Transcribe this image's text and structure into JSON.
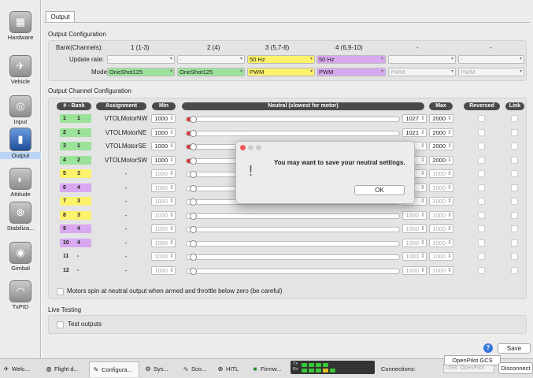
{
  "sidebar": {
    "items": [
      {
        "label": "Hardware",
        "icon": "chip-icon"
      },
      {
        "label": "Vehicle",
        "icon": "wing-icon"
      },
      {
        "label": "Input",
        "icon": "transmitter-icon"
      },
      {
        "label": "Output",
        "icon": "motor-icon"
      },
      {
        "label": "Attitude",
        "icon": "gauge-icon"
      },
      {
        "label": "Stabiliza...",
        "icon": "gyro-icon"
      },
      {
        "label": "Gimbal",
        "icon": "camera-icon"
      },
      {
        "label": "TxPID",
        "icon": "meter-icon"
      }
    ]
  },
  "tab": {
    "label": "Output"
  },
  "output_config": {
    "title": "Output Configuration",
    "bank_label": "Bank(Channels):",
    "update_label": "Update rate:",
    "mode_label": "Mode:",
    "banks": [
      {
        "channels": "1 (1-3)",
        "rate": "-",
        "mode": "OneShot125"
      },
      {
        "channels": "2 (4)",
        "rate": "-",
        "mode": "OneShot125"
      },
      {
        "channels": "3 (5,7-8)",
        "rate": "50 Hz",
        "mode": "PWM"
      },
      {
        "channels": "4 (6,9-10)",
        "rate": "50 Hz",
        "mode": "PWM"
      },
      {
        "channels": "-",
        "rate": "-",
        "mode": "PWM"
      },
      {
        "channels": "-",
        "rate": "-",
        "mode": "PWM"
      }
    ]
  },
  "channel_config": {
    "title": "Output Channel Configuration",
    "headers": {
      "bank": "# - Bank",
      "assignment": "Assignment",
      "min": "Min",
      "neutral": "Neutral (slowest for motor)",
      "max": "Max",
      "reversed": "Reversed",
      "link": "Link"
    },
    "rows": [
      {
        "ch": "1",
        "bank": "1",
        "assignment": "VTOLMotorNW",
        "min": "1000",
        "neutral": "1027",
        "max": "2000"
      },
      {
        "ch": "2",
        "bank": "1",
        "assignment": "VTOLMotorNE",
        "min": "1000",
        "neutral": "1021",
        "max": "2000"
      },
      {
        "ch": "3",
        "bank": "1",
        "assignment": "VTOLMotorSE",
        "min": "1000",
        "neutral": "",
        "max": "2000"
      },
      {
        "ch": "4",
        "bank": "2",
        "assignment": "VTOLMotorSW",
        "min": "1000",
        "neutral": "",
        "max": "2000"
      },
      {
        "ch": "5",
        "bank": "3",
        "assignment": "-",
        "min": "1000",
        "neutral": "",
        "max": "1000"
      },
      {
        "ch": "6",
        "bank": "4",
        "assignment": "-",
        "min": "1000",
        "neutral": "",
        "max": "1000"
      },
      {
        "ch": "7",
        "bank": "3",
        "assignment": "-",
        "min": "1000",
        "neutral": "",
        "max": "1000"
      },
      {
        "ch": "8",
        "bank": "3",
        "assignment": "-",
        "min": "1000",
        "neutral": "1000",
        "max": "1000"
      },
      {
        "ch": "9",
        "bank": "4",
        "assignment": "-",
        "min": "1000",
        "neutral": "1000",
        "max": "1000"
      },
      {
        "ch": "10",
        "bank": "4",
        "assignment": "-",
        "min": "1000",
        "neutral": "1000",
        "max": "1000"
      },
      {
        "ch": "11",
        "bank": "-",
        "assignment": "-",
        "min": "1000",
        "neutral": "1000",
        "max": "1000"
      },
      {
        "ch": "12",
        "bank": "-",
        "assignment": "-",
        "min": "1000",
        "neutral": "1000",
        "max": "1000"
      }
    ],
    "spin_checkbox": "Motors spin at neutral output when armed and throttle below zero (be careful)"
  },
  "live_testing": {
    "title": "Live Testing",
    "test_outputs": "Test outputs"
  },
  "dialog": {
    "message": "You may want to save your neutral settings.",
    "ok": "OK"
  },
  "save": {
    "label": "Save",
    "help": "?"
  },
  "bottom": {
    "tabs": [
      "Welc...",
      "Flight d...",
      "Configura...",
      "Sys...",
      "Sco...",
      "HITL",
      "Firmw..."
    ],
    "tx": "Tx",
    "rx": "Rx",
    "connections_label": "Connections:",
    "connection_value": "USB: OpenPilot",
    "tooltip": "OpenPilot GCS",
    "disconnect": "Disconnect"
  },
  "colors": {
    "bank1": "#9be29b",
    "bank2": "#9be29b",
    "bank3": "#fdf26b",
    "bank4": "#d8a8f0",
    "active": "#3477d9"
  }
}
